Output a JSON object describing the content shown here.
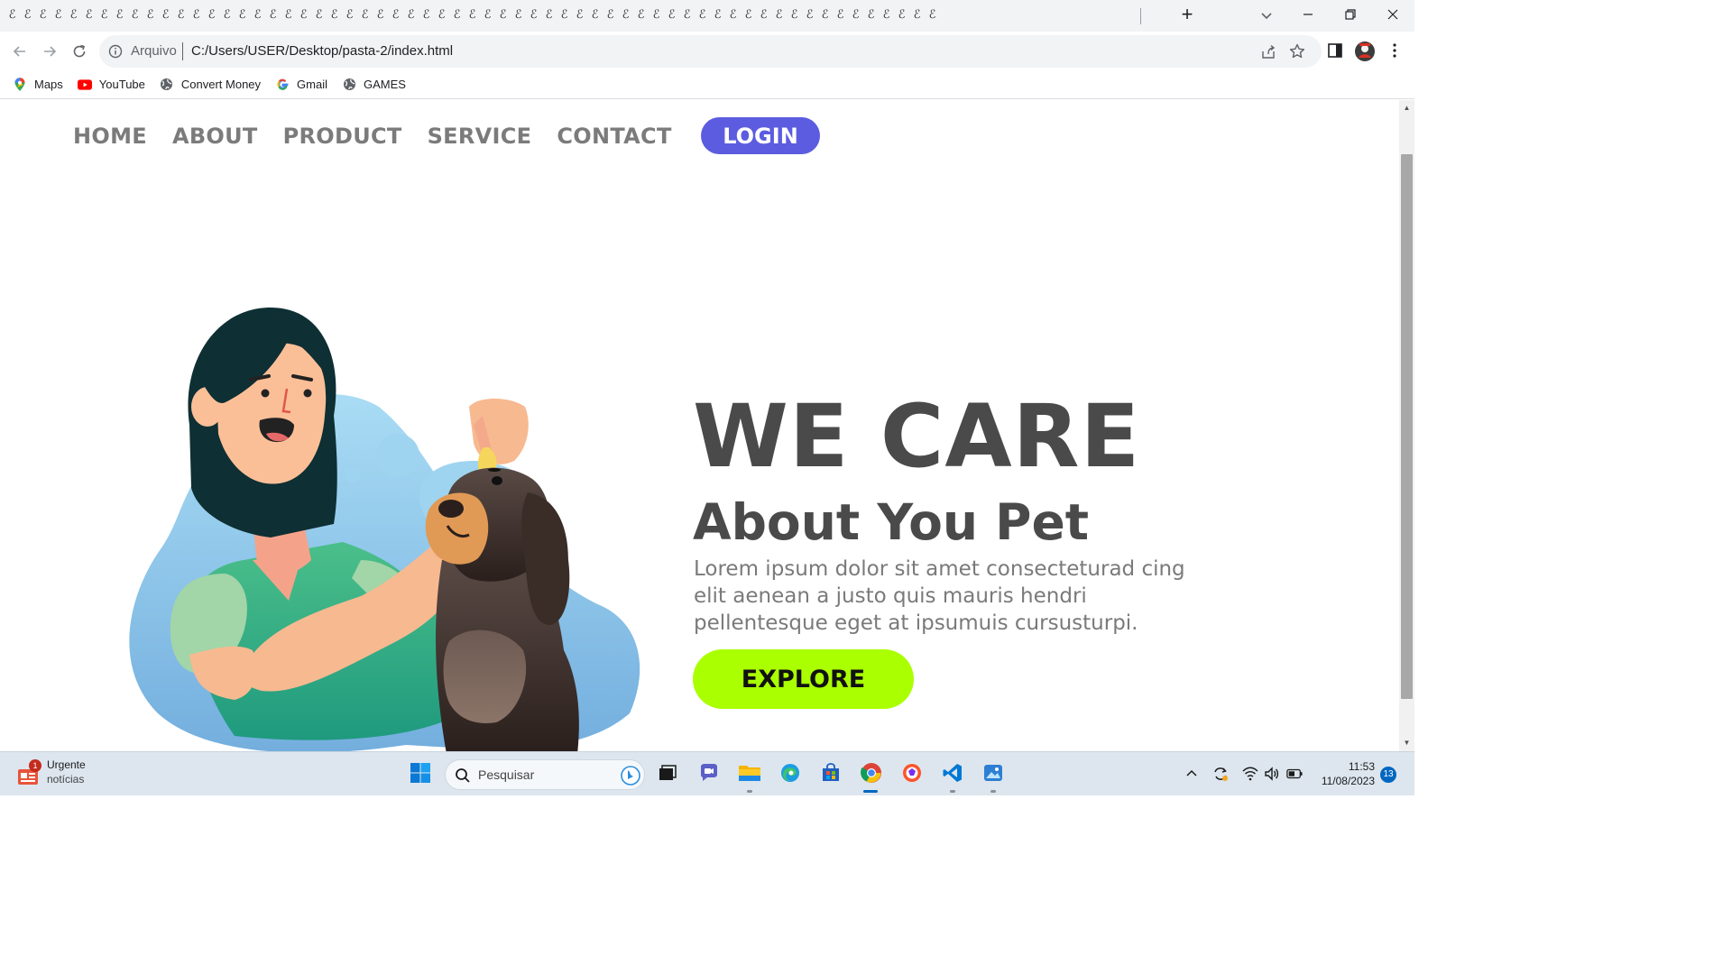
{
  "browser": {
    "tab_glyph": "ℰ",
    "new_tab_label": "+",
    "address": {
      "scheme_label": "Arquivo",
      "url": "C:/Users/USER/Desktop/pasta-2/index.html"
    },
    "bookmarks": [
      {
        "label": "Maps",
        "icon": "maps-pin-icon"
      },
      {
        "label": "YouTube",
        "icon": "youtube-icon"
      },
      {
        "label": "Convert Money",
        "icon": "globe-icon"
      },
      {
        "label": "Gmail",
        "icon": "google-g-icon"
      },
      {
        "label": "GAMES",
        "icon": "globe-icon"
      }
    ]
  },
  "site": {
    "nav": [
      "HOME",
      "ABOUT",
      "PRODUCT",
      "SERVICE",
      "CONTACT"
    ],
    "login_label": "LOGIN",
    "hero": {
      "title": "WE CARE",
      "subtitle": "About You Pet",
      "text": "Lorem ipsum dolor sit amet consecteturad cing elit aenean a justo quis mauris hendri pellentesque eget at ipsumuis cursusturpi.",
      "cta": "EXPLORE"
    },
    "colors": {
      "login": "#5c5ce0",
      "cta": "#aaff00",
      "heading": "#4a4a4a",
      "nav": "#7b7b7b"
    }
  },
  "taskbar": {
    "news": {
      "title": "Urgente",
      "subtitle": "notícias",
      "badge": "1"
    },
    "search_placeholder": "Pesquisar",
    "clock_time": "11:53",
    "clock_date": "11/08/2023",
    "notification_count": "13"
  }
}
